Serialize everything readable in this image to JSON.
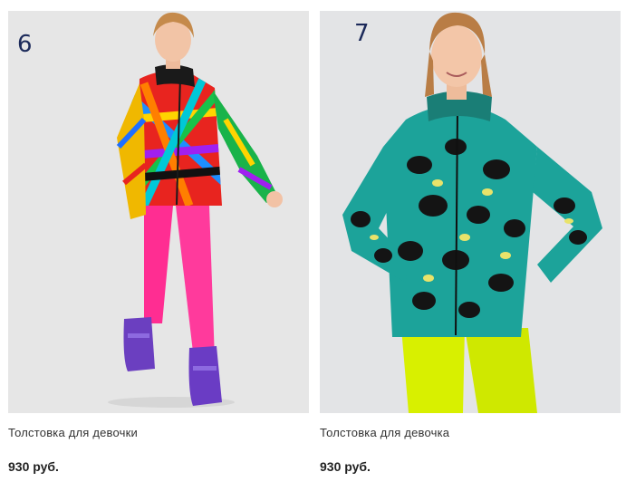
{
  "products": [
    {
      "badge": "6",
      "title": "Толстовка для девочки",
      "price": "930 руб.",
      "image_alt": "girl-in-rainbow-fleece-jacket-pink-leggings-purple-boots"
    },
    {
      "badge": "7",
      "title": "Толстовка для девочка",
      "price": "930 руб.",
      "image_alt": "girl-in-leopard-teal-fleece-jacket-neon-yellow-leggings"
    }
  ]
}
